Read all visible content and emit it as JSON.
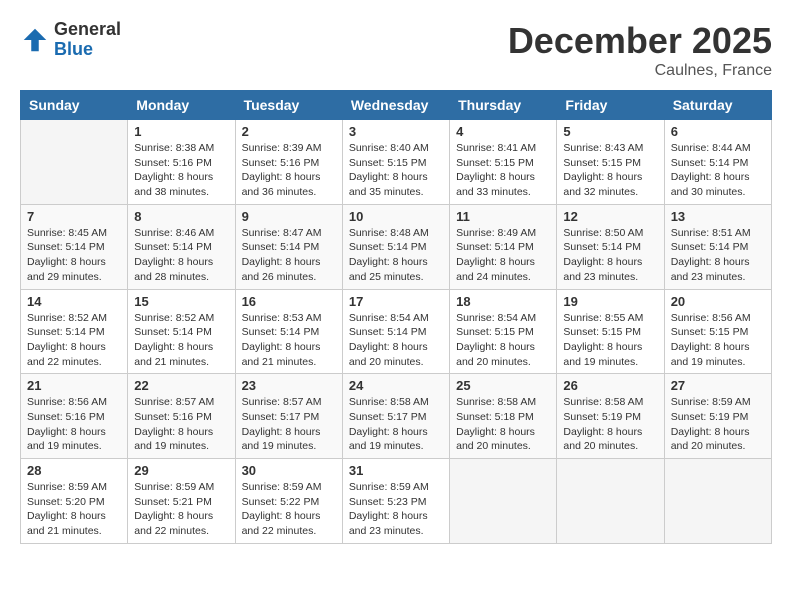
{
  "logo": {
    "general": "General",
    "blue": "Blue"
  },
  "title": "December 2025",
  "location": "Caulnes, France",
  "days_of_week": [
    "Sunday",
    "Monday",
    "Tuesday",
    "Wednesday",
    "Thursday",
    "Friday",
    "Saturday"
  ],
  "weeks": [
    [
      {
        "day": "",
        "info": ""
      },
      {
        "day": "1",
        "info": "Sunrise: 8:38 AM\nSunset: 5:16 PM\nDaylight: 8 hours\nand 38 minutes."
      },
      {
        "day": "2",
        "info": "Sunrise: 8:39 AM\nSunset: 5:16 PM\nDaylight: 8 hours\nand 36 minutes."
      },
      {
        "day": "3",
        "info": "Sunrise: 8:40 AM\nSunset: 5:15 PM\nDaylight: 8 hours\nand 35 minutes."
      },
      {
        "day": "4",
        "info": "Sunrise: 8:41 AM\nSunset: 5:15 PM\nDaylight: 8 hours\nand 33 minutes."
      },
      {
        "day": "5",
        "info": "Sunrise: 8:43 AM\nSunset: 5:15 PM\nDaylight: 8 hours\nand 32 minutes."
      },
      {
        "day": "6",
        "info": "Sunrise: 8:44 AM\nSunset: 5:14 PM\nDaylight: 8 hours\nand 30 minutes."
      }
    ],
    [
      {
        "day": "7",
        "info": "Sunrise: 8:45 AM\nSunset: 5:14 PM\nDaylight: 8 hours\nand 29 minutes."
      },
      {
        "day": "8",
        "info": "Sunrise: 8:46 AM\nSunset: 5:14 PM\nDaylight: 8 hours\nand 28 minutes."
      },
      {
        "day": "9",
        "info": "Sunrise: 8:47 AM\nSunset: 5:14 PM\nDaylight: 8 hours\nand 26 minutes."
      },
      {
        "day": "10",
        "info": "Sunrise: 8:48 AM\nSunset: 5:14 PM\nDaylight: 8 hours\nand 25 minutes."
      },
      {
        "day": "11",
        "info": "Sunrise: 8:49 AM\nSunset: 5:14 PM\nDaylight: 8 hours\nand 24 minutes."
      },
      {
        "day": "12",
        "info": "Sunrise: 8:50 AM\nSunset: 5:14 PM\nDaylight: 8 hours\nand 23 minutes."
      },
      {
        "day": "13",
        "info": "Sunrise: 8:51 AM\nSunset: 5:14 PM\nDaylight: 8 hours\nand 23 minutes."
      }
    ],
    [
      {
        "day": "14",
        "info": "Sunrise: 8:52 AM\nSunset: 5:14 PM\nDaylight: 8 hours\nand 22 minutes."
      },
      {
        "day": "15",
        "info": "Sunrise: 8:52 AM\nSunset: 5:14 PM\nDaylight: 8 hours\nand 21 minutes."
      },
      {
        "day": "16",
        "info": "Sunrise: 8:53 AM\nSunset: 5:14 PM\nDaylight: 8 hours\nand 21 minutes."
      },
      {
        "day": "17",
        "info": "Sunrise: 8:54 AM\nSunset: 5:14 PM\nDaylight: 8 hours\nand 20 minutes."
      },
      {
        "day": "18",
        "info": "Sunrise: 8:54 AM\nSunset: 5:15 PM\nDaylight: 8 hours\nand 20 minutes."
      },
      {
        "day": "19",
        "info": "Sunrise: 8:55 AM\nSunset: 5:15 PM\nDaylight: 8 hours\nand 19 minutes."
      },
      {
        "day": "20",
        "info": "Sunrise: 8:56 AM\nSunset: 5:15 PM\nDaylight: 8 hours\nand 19 minutes."
      }
    ],
    [
      {
        "day": "21",
        "info": "Sunrise: 8:56 AM\nSunset: 5:16 PM\nDaylight: 8 hours\nand 19 minutes."
      },
      {
        "day": "22",
        "info": "Sunrise: 8:57 AM\nSunset: 5:16 PM\nDaylight: 8 hours\nand 19 minutes."
      },
      {
        "day": "23",
        "info": "Sunrise: 8:57 AM\nSunset: 5:17 PM\nDaylight: 8 hours\nand 19 minutes."
      },
      {
        "day": "24",
        "info": "Sunrise: 8:58 AM\nSunset: 5:17 PM\nDaylight: 8 hours\nand 19 minutes."
      },
      {
        "day": "25",
        "info": "Sunrise: 8:58 AM\nSunset: 5:18 PM\nDaylight: 8 hours\nand 20 minutes."
      },
      {
        "day": "26",
        "info": "Sunrise: 8:58 AM\nSunset: 5:19 PM\nDaylight: 8 hours\nand 20 minutes."
      },
      {
        "day": "27",
        "info": "Sunrise: 8:59 AM\nSunset: 5:19 PM\nDaylight: 8 hours\nand 20 minutes."
      }
    ],
    [
      {
        "day": "28",
        "info": "Sunrise: 8:59 AM\nSunset: 5:20 PM\nDaylight: 8 hours\nand 21 minutes."
      },
      {
        "day": "29",
        "info": "Sunrise: 8:59 AM\nSunset: 5:21 PM\nDaylight: 8 hours\nand 22 minutes."
      },
      {
        "day": "30",
        "info": "Sunrise: 8:59 AM\nSunset: 5:22 PM\nDaylight: 8 hours\nand 22 minutes."
      },
      {
        "day": "31",
        "info": "Sunrise: 8:59 AM\nSunset: 5:23 PM\nDaylight: 8 hours\nand 23 minutes."
      },
      {
        "day": "",
        "info": ""
      },
      {
        "day": "",
        "info": ""
      },
      {
        "day": "",
        "info": ""
      }
    ]
  ]
}
